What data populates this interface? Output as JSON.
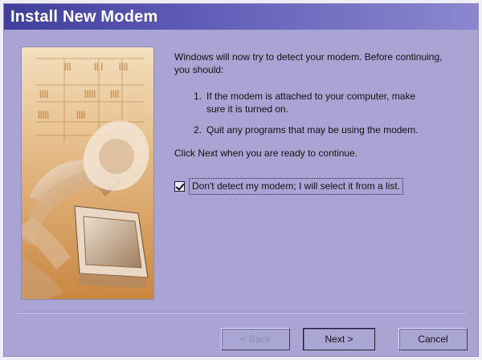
{
  "window": {
    "title": "Install New Modem"
  },
  "content": {
    "intro": "Windows will now try to detect your modem.  Before continuing, you should:",
    "steps": [
      {
        "number": "1.",
        "text": "If the modem is attached to your computer, make sure it is turned on."
      },
      {
        "number": "2.",
        "text": "Quit any programs that may be using the modem."
      }
    ],
    "ready": "Click Next when you are ready to continue.",
    "checkbox": {
      "label": "Don't detect my modem; I will select it from a list.",
      "checked": true
    }
  },
  "buttons": {
    "back": "< Back",
    "next": "Next >",
    "cancel": "Cancel"
  },
  "icons": {
    "checkbox_icon": "checkbox-checked-icon"
  },
  "colors": {
    "window_background": "#a9a4d4",
    "title_gradient_start": "#3f3e9a",
    "title_gradient_end": "#8c87cf",
    "image_warm_tone": "#d9a564",
    "button_face": "#aaa6d4"
  }
}
